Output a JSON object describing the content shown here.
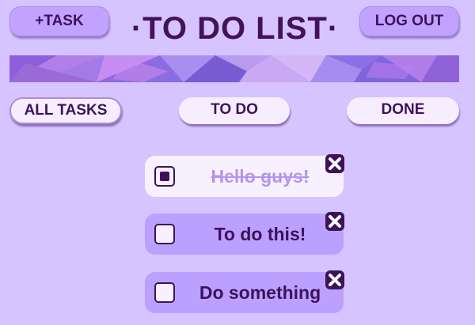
{
  "header": {
    "add_task_label": "+TASK",
    "title": "·TO DO LIST·",
    "logout_label": "LOG OUT"
  },
  "filters": {
    "all": "ALL TASKS",
    "todo": "TO DO",
    "done": "DONE",
    "selected": "ALL TASKS"
  },
  "tasks": [
    {
      "text": "Hello guys!",
      "completed": true
    },
    {
      "text": "To do this!",
      "completed": false
    },
    {
      "text": "Do something",
      "completed": false
    }
  ],
  "colors": {
    "background": "#d5c4ff",
    "accent": "#3d1259",
    "button": "#c1a3ff",
    "task_open": "#bca0ff",
    "task_done": "#f7f1ff"
  },
  "icons": {
    "delete": "close-icon",
    "checkbox": "checkbox-icon"
  }
}
